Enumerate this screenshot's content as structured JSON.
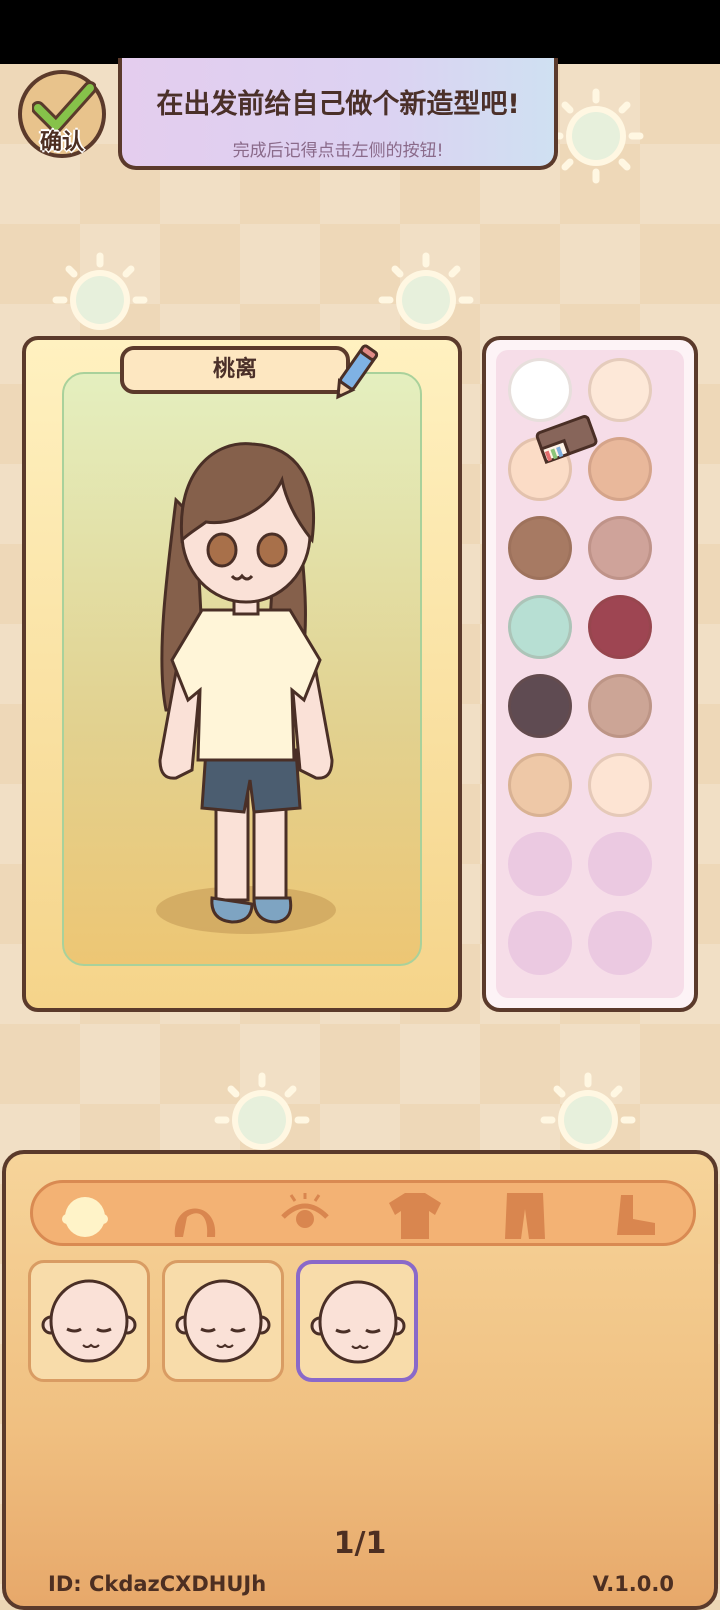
{
  "header": {
    "confirm_label": "确认",
    "banner_title": "在出发前给自己做个新造型吧!",
    "banner_subtitle": "完成后记得点击左侧的按钮!"
  },
  "character": {
    "name": "桃离"
  },
  "palette": {
    "colors": [
      "#ffffff",
      "#fde8d8",
      "#fbdcc6",
      "#e9b89b",
      "#a77a63",
      "#cfa39a",
      "#b7dfd3",
      "#9e4552",
      "#5f4b52",
      "#cca596",
      "#eec8a7",
      "#fde4d3",
      "#ebc9e1",
      "#ebc9e1",
      "#ebc9e1",
      "#ebc9e1"
    ],
    "empty_color": "#ebc9e1"
  },
  "tabs": [
    {
      "id": "face",
      "icon": "face-icon"
    },
    {
      "id": "hair",
      "icon": "hair-icon"
    },
    {
      "id": "eyes",
      "icon": "eye-icon"
    },
    {
      "id": "top",
      "icon": "shirt-icon"
    },
    {
      "id": "bottom",
      "icon": "pants-icon"
    },
    {
      "id": "shoes",
      "icon": "shoe-icon"
    }
  ],
  "face_options": [
    {
      "selected": false
    },
    {
      "selected": false
    },
    {
      "selected": true
    }
  ],
  "footer": {
    "page": "1/1",
    "id_text": "ID:  CkdazCXDHUJh",
    "version": "V.1.0.0"
  }
}
